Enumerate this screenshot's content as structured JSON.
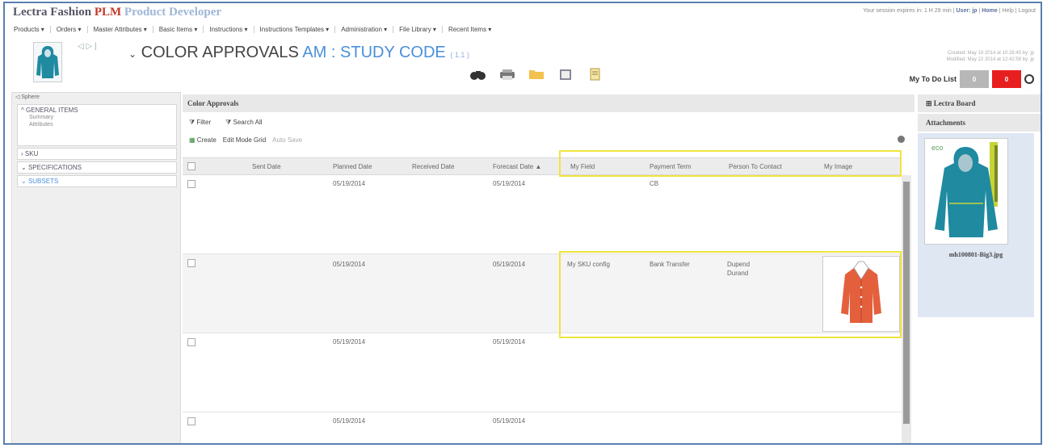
{
  "app": {
    "brand": "Lectra Fashion",
    "brand_plm": "PLM",
    "brand_pd": "Product Developer",
    "session_text": "Your session expires in: 1 H 29 min | ",
    "user_link": "User: jp",
    "home_link": "Home",
    "help_link": "Help",
    "logout_link": "Logout"
  },
  "menu": [
    "Products ▾",
    "Orders ▾",
    "Master Attributes ▾",
    "Basic Items ▾",
    "Instructions ▾",
    "Instructions Templates ▾",
    "Administration ▾",
    "File Library ▾",
    "Recent Items ▾"
  ],
  "header": {
    "title": "COLOR APPROVALS",
    "code": "AM : STUDY CODE",
    "version": "( 1.1 )",
    "created": "Created: May 19 2014 at 10:28:45 by: jp",
    "modified": "Modified: May 22 2014 at 12:42:58 by: jp"
  },
  "todo": {
    "label": "My To Do List",
    "grey_count": "0",
    "red_count": "0"
  },
  "left": {
    "head": "Sphere",
    "sections": [
      {
        "label": "GENERAL ITEMS",
        "subs": [
          "Summary",
          "Attributes"
        ]
      },
      {
        "label": "SKU",
        "subs": []
      },
      {
        "label": "SPECIFICATIONS",
        "subs": []
      },
      {
        "label": "SUBSETS",
        "subs": []
      }
    ]
  },
  "grid": {
    "section_title": "Color Approvals",
    "filter_label": "Filter",
    "search_label": "Search All",
    "create_label": "Create",
    "edit_label": "Edit Mode Grid",
    "autosave_label": "Auto Save",
    "columns": [
      "Sent Date",
      "Planned Date",
      "Received Date",
      "Forecast Date ▲",
      "My Field",
      "Payment Term",
      "Person To Contact",
      "My Image"
    ],
    "rows": [
      {
        "sent": "",
        "planned": "05/19/2014",
        "received": "",
        "forecast": "05/19/2014",
        "my_field": "",
        "payment": "CB",
        "person": "",
        "person2": ""
      },
      {
        "sent": "",
        "planned": "05/19/2014",
        "received": "",
        "forecast": "05/19/2014",
        "my_field": "My SKU config",
        "payment": "Bank Transfer",
        "person": "Dupend",
        "person2": "Durand"
      },
      {
        "sent": "",
        "planned": "05/19/2014",
        "received": "",
        "forecast": "05/19/2014",
        "my_field": "",
        "payment": "",
        "person": "",
        "person2": ""
      },
      {
        "sent": "",
        "planned": "05/19/2014",
        "received": "",
        "forecast": "05/19/2014",
        "my_field": "",
        "payment": "",
        "person": "",
        "person2": ""
      }
    ]
  },
  "right": {
    "board_label": "Lectra Board",
    "attach_label": "Attachments",
    "attach_brand": "eco",
    "filename": "mh100801-Big3.jpg"
  },
  "colors": {
    "accent": "#4a90d9",
    "highlight": "#f0e43c",
    "todo_red": "#e81f1f",
    "jacket_teal": "#1f8aa0",
    "jacket_orange": "#e4603d"
  }
}
